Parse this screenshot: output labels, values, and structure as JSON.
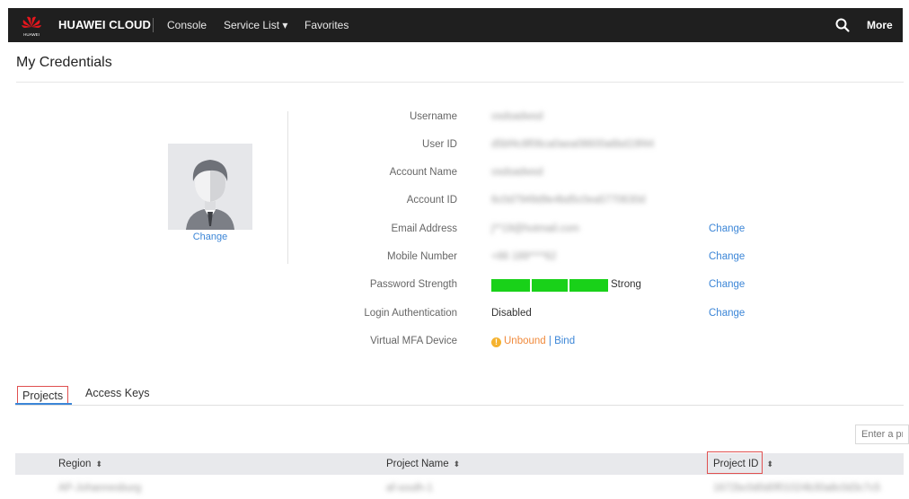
{
  "topbar": {
    "logo_text": "HUAWEI",
    "brand": "HUAWEI CLOUD",
    "nav": {
      "console": "Console",
      "service_list": "Service List ▾",
      "favorites": "Favorites"
    },
    "more": "More",
    "icons": [
      "huawei-logo",
      "search-icon"
    ]
  },
  "page_title": "My Credentials",
  "avatar": {
    "change_label": "Change"
  },
  "info": {
    "username": {
      "label": "Username",
      "value": "osdsadwsd"
    },
    "user_id": {
      "label": "User ID",
      "value": "d5bf4c8f06ca0aea08600a6bd19f44"
    },
    "account_name": {
      "label": "Account Name",
      "value": "osdsadwsd"
    },
    "account_id": {
      "label": "Account ID",
      "value": "6c0d7949d9e4bd5c0ea5770630d"
    },
    "email": {
      "label": "Email Address",
      "value": "j**19@hotmail.com",
      "change": "Change"
    },
    "mobile": {
      "label": "Mobile Number",
      "value": "+86 189****62",
      "change": "Change"
    },
    "password_strength": {
      "label": "Password Strength",
      "value": "Strong",
      "level": 1.0,
      "change": "Change",
      "bar_color": "#19d119"
    },
    "login_auth": {
      "label": "Login Authentication",
      "value": "Disabled",
      "change": "Change"
    },
    "mfa": {
      "label": "Virtual MFA Device",
      "status": "Unbound",
      "separator": " | ",
      "bind": "Bind"
    }
  },
  "tabs": {
    "projects": "Projects",
    "access_keys": "Access Keys"
  },
  "search": {
    "placeholder": "Enter a project name"
  },
  "table": {
    "columns": [
      "Region",
      "Project Name",
      "Project ID"
    ],
    "sort_icon": "⬍",
    "rows": [
      {
        "region": "AP-Johannesburg",
        "project_name": "af-south-1",
        "project_id": "1672bc0d0d0f01024b30a8c0d3c7c5"
      }
    ]
  },
  "colors": {
    "accent": "#3c86d7",
    "highlight_border": "#e05050",
    "warning": "#f5b22e",
    "topbar": "#1f1f1f"
  }
}
